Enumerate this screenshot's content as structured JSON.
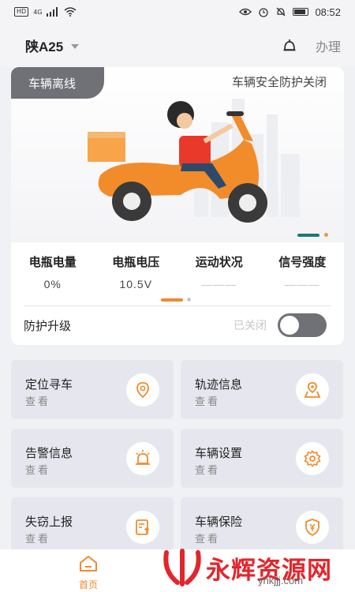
{
  "status_bar": {
    "time": "08:52",
    "network_badge": "HD",
    "signal_label": "4G"
  },
  "header": {
    "plate": "陕A25",
    "action": "办理"
  },
  "banner": {
    "offline_tag": "车辆离线",
    "protect_status": "车辆安全防护关闭"
  },
  "stats": [
    {
      "label": "电瓶电量",
      "value": "0%"
    },
    {
      "label": "电瓶电压",
      "value": "10.5V"
    },
    {
      "label": "运动状况",
      "value": "———"
    },
    {
      "label": "信号强度",
      "value": "———"
    }
  ],
  "protect_upgrade": {
    "label": "防护升级",
    "state": "已关闭",
    "enabled": false
  },
  "tiles": [
    {
      "title": "定位寻车",
      "sub": "查看",
      "icon": "location-pin-icon"
    },
    {
      "title": "轨迹信息",
      "sub": "查看",
      "icon": "map-pin-icon"
    },
    {
      "title": "告警信息",
      "sub": "查看",
      "icon": "alarm-siren-icon"
    },
    {
      "title": "车辆设置",
      "sub": "查看",
      "icon": "gear-icon"
    },
    {
      "title": "失窃上报",
      "sub": "查看",
      "icon": "report-upload-icon"
    },
    {
      "title": "车辆保险",
      "sub": "查看",
      "icon": "insurance-shield-icon"
    }
  ],
  "nav": {
    "home_label": "首页"
  },
  "watermark": {
    "text": "永辉资源网",
    "url": "yhkjjj.com"
  },
  "colors": {
    "accent": "#f08a2c",
    "offline_gray": "#707176",
    "tile_bg": "#e6e7ee",
    "watermark_red": "#e2262c"
  }
}
